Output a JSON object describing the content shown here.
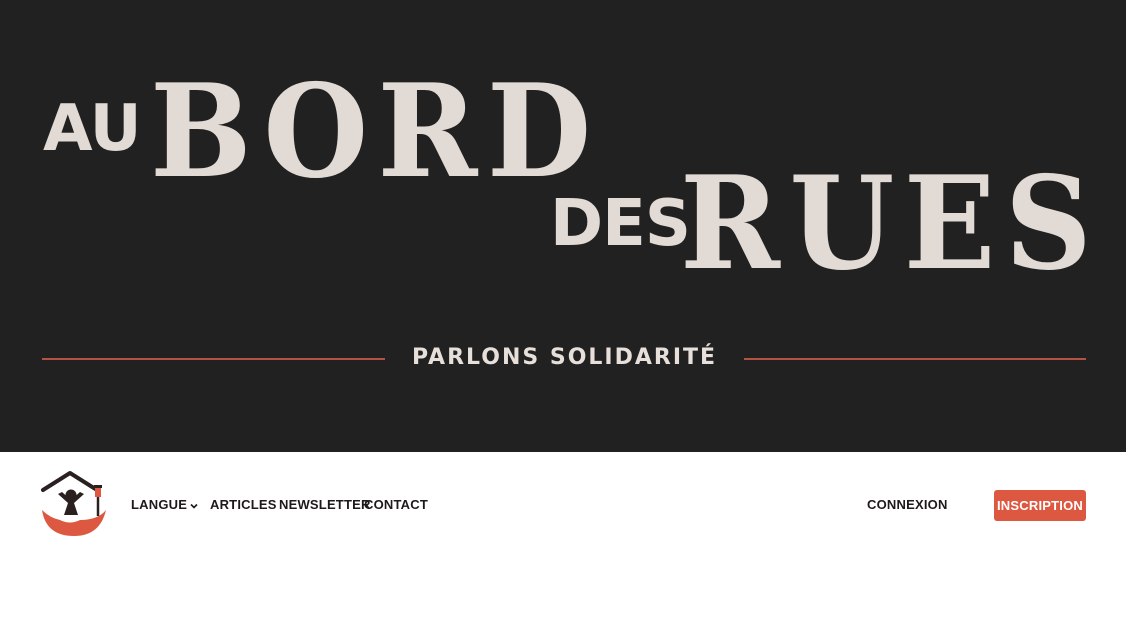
{
  "hero": {
    "title_words": [
      "AU",
      "BORD",
      "DES",
      "RUES"
    ],
    "tagline": "PARLONS SOLIDARITÉ"
  },
  "nav": {
    "items": [
      {
        "label": "LANGUE",
        "has_dropdown": true
      },
      {
        "label": "ARTICLES"
      },
      {
        "label": "NEWSLETTER"
      },
      {
        "label": "CONTACT"
      }
    ],
    "login_label": "CONNEXION",
    "signup_label": "INSCRIPTION"
  },
  "icons": {
    "logo": "house-hand-person-logo-icon",
    "dropdown": "chevron-down-icon"
  },
  "colors": {
    "hero_bg": "#222121",
    "title_text": "#e1dad5",
    "accent_line": "#b45344",
    "signup_button": "#dd5840",
    "logo_dark": "#2a2020"
  }
}
